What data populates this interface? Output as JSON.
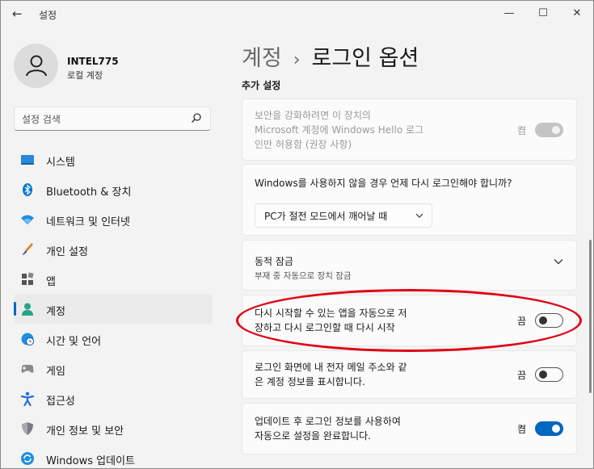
{
  "titlebar": {
    "title": "설정",
    "back": "←",
    "minimize": "—",
    "maximize": "☐",
    "close": "✕"
  },
  "user": {
    "name": "INTEL775",
    "account_type": "로컬 계정"
  },
  "search": {
    "placeholder": "설정 검색"
  },
  "nav": [
    {
      "label": "시스템",
      "icon": "system-icon"
    },
    {
      "label": "Bluetooth & 장치",
      "icon": "bluetooth-icon"
    },
    {
      "label": "네트워크 및 인터넷",
      "icon": "wifi-icon"
    },
    {
      "label": "개인 설정",
      "icon": "brush-icon"
    },
    {
      "label": "앱",
      "icon": "apps-icon"
    },
    {
      "label": "계정",
      "icon": "account-icon",
      "active": true
    },
    {
      "label": "시간 및 언어",
      "icon": "globe-clock-icon"
    },
    {
      "label": "게임",
      "icon": "gamepad-icon"
    },
    {
      "label": "접근성",
      "icon": "accessibility-icon"
    },
    {
      "label": "개인 정보 및 보안",
      "icon": "shield-icon"
    },
    {
      "label": "Windows 업데이트",
      "icon": "update-icon"
    }
  ],
  "page": {
    "breadcrumb": "계정",
    "separator": "›",
    "title": "로그인 옵션"
  },
  "section_title": "추가 설정",
  "settings": {
    "hello_only": {
      "line1": "보안을 강화하려면 이 장치의",
      "line2": "Microsoft 계정에 Windows Hello 로그",
      "line3": "인만 허용함 (권장 사항)",
      "state": "켬"
    },
    "require_signin": {
      "question": "Windows를 사용하지 않을 경우 언제 다시 로그인해야 합니까?",
      "dropdown_value": "PC가 절전 모드에서 깨어날 때"
    },
    "dynamic_lock": {
      "title": "동적 잠금",
      "subtitle": "부재 중 자동으로 장치 잠금"
    },
    "restart_apps": {
      "line1": "다시 시작할 수 있는 앱을 자동으로 저",
      "line2": "장하고 다시 로그인할 때 다시 시작",
      "state": "끔"
    },
    "show_email": {
      "line1": "로그인 화면에 내 전자 메일 주소와 같",
      "line2": "은 계정 정보를 표시합니다.",
      "state": "끔"
    },
    "use_signin_info": {
      "line1": "업데이트 후 로그인 정보를 사용하여",
      "line2": "자동으로 설정을 완료합니다.",
      "state": "켬"
    }
  },
  "colors": {
    "accent": "#0067c0",
    "highlight": "#e00012"
  }
}
